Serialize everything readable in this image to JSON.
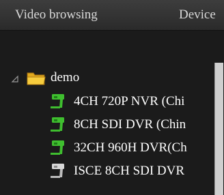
{
  "tabs": {
    "video_browsing": "Video browsing",
    "device": "Device"
  },
  "tree": {
    "root": {
      "label": "demo",
      "expanded": true,
      "icon": "folder-icon"
    },
    "devices": [
      {
        "label": "4CH 720P NVR (Chi",
        "status": "online",
        "icon": "camera-icon"
      },
      {
        "label": "8CH SDI DVR (Chin",
        "status": "online",
        "icon": "camera-icon"
      },
      {
        "label": "32CH 960H DVR(Ch",
        "status": "online",
        "icon": "camera-icon"
      },
      {
        "label": "ISCE 8CH SDI DVR",
        "status": "offline",
        "icon": "camera-icon"
      }
    ]
  },
  "colors": {
    "online_camera": "#3fbf2f",
    "offline_camera": "#d8d8d8",
    "folder": "#f2c230"
  }
}
